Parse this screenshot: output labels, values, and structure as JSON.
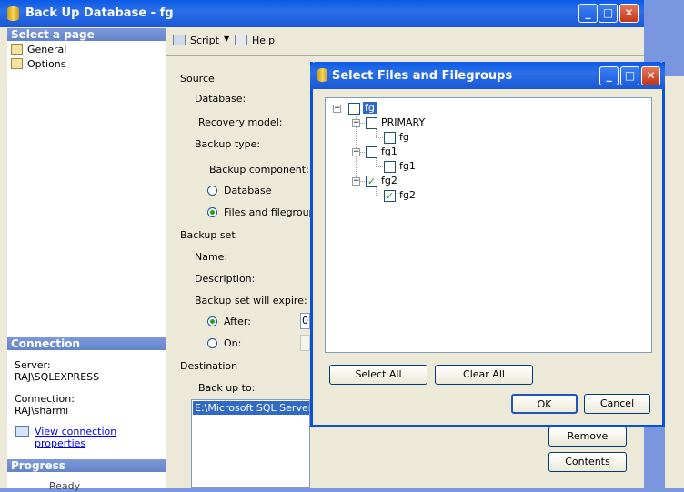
{
  "main_window": {
    "title": "Back Up Database - fg",
    "select_page_header": "Select a page",
    "pages": [
      "General",
      "Options"
    ],
    "toolbar": {
      "script_label": "Script",
      "help_label": "Help"
    },
    "source_section": "Source",
    "database_label": "Database:",
    "recovery_model_label": "Recovery model:",
    "backup_type_label": "Backup type:",
    "backup_component_label": "Backup component:",
    "component_database": "Database",
    "component_files": "Files and filegroups:",
    "backup_set_section": "Backup set",
    "name_label": "Name:",
    "description_label": "Description:",
    "expire_label": "Backup set will expire:",
    "after_label": "After:",
    "after_value": "0",
    "on_label": "On:",
    "destination_section": "Destination",
    "backup_to_label": "Back up to:",
    "destination_path": "E:\\Microsoft SQL Server\\M",
    "remove_button": "Remove",
    "contents_button": "Contents",
    "connection_header": "Connection",
    "server_label": "Server:",
    "server_value": "RAJ\\SQLEXPRESS",
    "connection_label": "Connection:",
    "connection_value": "RAJ\\sharmi",
    "view_connection_link": "View connection properties",
    "progress_header": "Progress",
    "progress_status": "Ready"
  },
  "dialog": {
    "title": "Select Files and Filegroups",
    "tree": {
      "root": "fg",
      "primary": "PRIMARY",
      "primary_file": "fg",
      "fg1": "fg1",
      "fg1_file": "fg1",
      "fg2": "fg2",
      "fg2_file": "fg2"
    },
    "select_all_button": "Select All",
    "clear_all_button": "Clear All",
    "ok_button": "OK",
    "cancel_button": "Cancel"
  },
  "colors": {
    "titlebar": "#0a5ae8",
    "checkmark": "#21a121",
    "section_header": "#7d9ad9"
  },
  "icons": [
    "database-icon",
    "page-icon",
    "script-icon",
    "help-icon",
    "connection-icon"
  ]
}
